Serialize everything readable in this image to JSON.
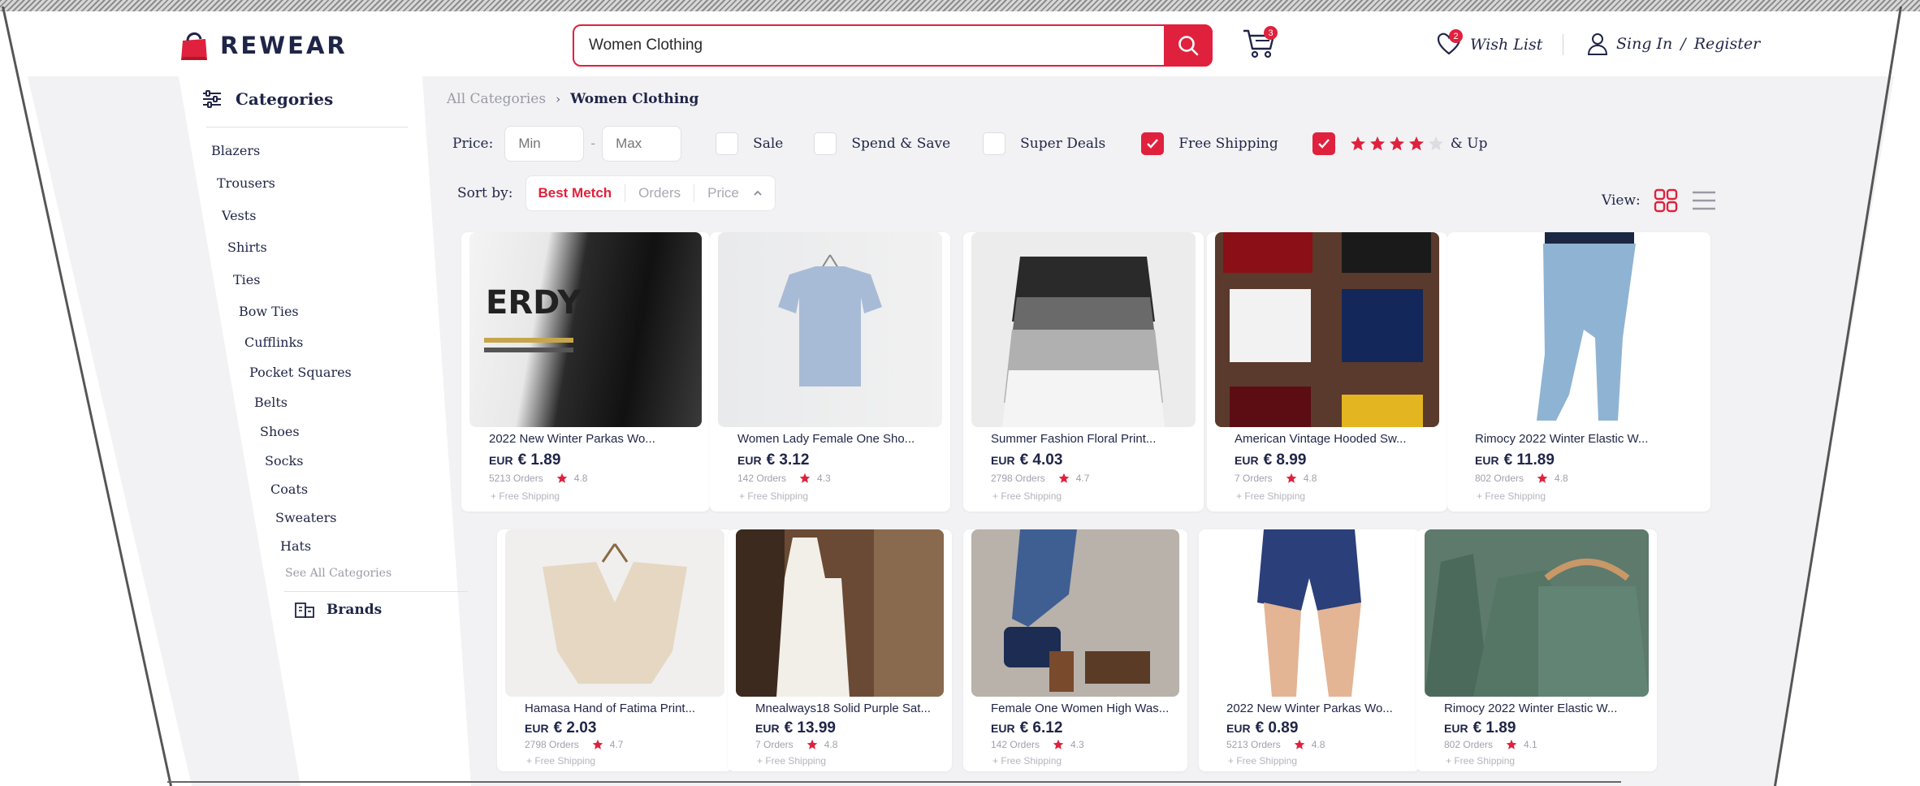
{
  "brand": {
    "name": "REWEAR"
  },
  "search": {
    "value": "Women Clothing"
  },
  "cart": {
    "count": "3"
  },
  "header": {
    "wishlist_label": "Wish List",
    "wishlist_count": "2",
    "sign_in": "Sing In",
    "separator": "/",
    "register": "Register"
  },
  "sidebar": {
    "title": "Categories",
    "items": [
      "Blazers",
      "Trousers",
      "Vests",
      "Shirts",
      "Ties",
      "Bow Ties",
      "Cufflinks",
      "Pocket Squares",
      "Belts",
      "Shoes",
      "Socks",
      "Coats",
      "Sweaters",
      "Hats"
    ],
    "see_all": "See All Categories",
    "brands": "Brands"
  },
  "breadcrumb": {
    "root": "All Categories",
    "current": "Women Clothing"
  },
  "filters": {
    "price_label": "Price:",
    "min_placeholder": "Min",
    "max_placeholder": "Max",
    "dash": "-",
    "sale": "Sale",
    "spend_save": "Spend & Save",
    "super_deals": "Super Deals",
    "free_shipping": "Free Shipping",
    "rating_suffix": "& Up",
    "rating_value": 4
  },
  "sort": {
    "label": "Sort by:",
    "options": [
      "Best Metch",
      "Orders",
      "Price"
    ]
  },
  "view": {
    "label": "View:"
  },
  "colors": {
    "accent": "#e0213d",
    "navy": "#1f2547"
  },
  "products": [
    {
      "title": "2022 New Winter Parkas Wo...",
      "currency": "EUR",
      "price": "€ 1.89",
      "orders": "5213 Orders",
      "rating": "4.8",
      "shipping": "+ Free Shipping"
    },
    {
      "title": "Women Lady Female One Sho...",
      "currency": "EUR",
      "price": "€ 3.12",
      "orders": "142 Orders",
      "rating": "4.3",
      "shipping": "+ Free Shipping"
    },
    {
      "title": "Summer Fashion Floral Print...",
      "currency": "EUR",
      "price": "€ 4.03",
      "orders": "2798 Orders",
      "rating": "4.7",
      "shipping": "+ Free Shipping"
    },
    {
      "title": "American Vintage  Hooded Sw...",
      "currency": "EUR",
      "price": "€ 8.99",
      "orders": "7 Orders",
      "rating": "4.8",
      "shipping": "+ Free Shipping"
    },
    {
      "title": "Rimocy 2022 Winter Elastic W...",
      "currency": "EUR",
      "price": "€ 11.89",
      "orders": "802 Orders",
      "rating": "4.8",
      "shipping": "+ Free Shipping"
    },
    {
      "title": "Hamasa Hand of Fatima Print...",
      "currency": "EUR",
      "price": "€ 2.03",
      "orders": "2798 Orders",
      "rating": "4.7",
      "shipping": "+ Free Shipping"
    },
    {
      "title": "Mnealways18 Solid Purple Sat...",
      "currency": "EUR",
      "price": "€ 13.99",
      "orders": "7 Orders",
      "rating": "4.8",
      "shipping": "+ Free Shipping"
    },
    {
      "title": "Female One Women High Was...",
      "currency": "EUR",
      "price": "€ 6.12",
      "orders": "142 Orders",
      "rating": "4.3",
      "shipping": "+ Free Shipping"
    },
    {
      "title": "2022 New Winter Parkas Wo...",
      "currency": "EUR",
      "price": "€ 0.89",
      "orders": "5213 Orders",
      "rating": "4.8",
      "shipping": "+ Free Shipping"
    },
    {
      "title": "Rimocy 2022 Winter Elastic W...",
      "currency": "EUR",
      "price": "€ 1.89",
      "orders": "802 Orders",
      "rating": "4.1",
      "shipping": "+ Free Shipping"
    }
  ]
}
